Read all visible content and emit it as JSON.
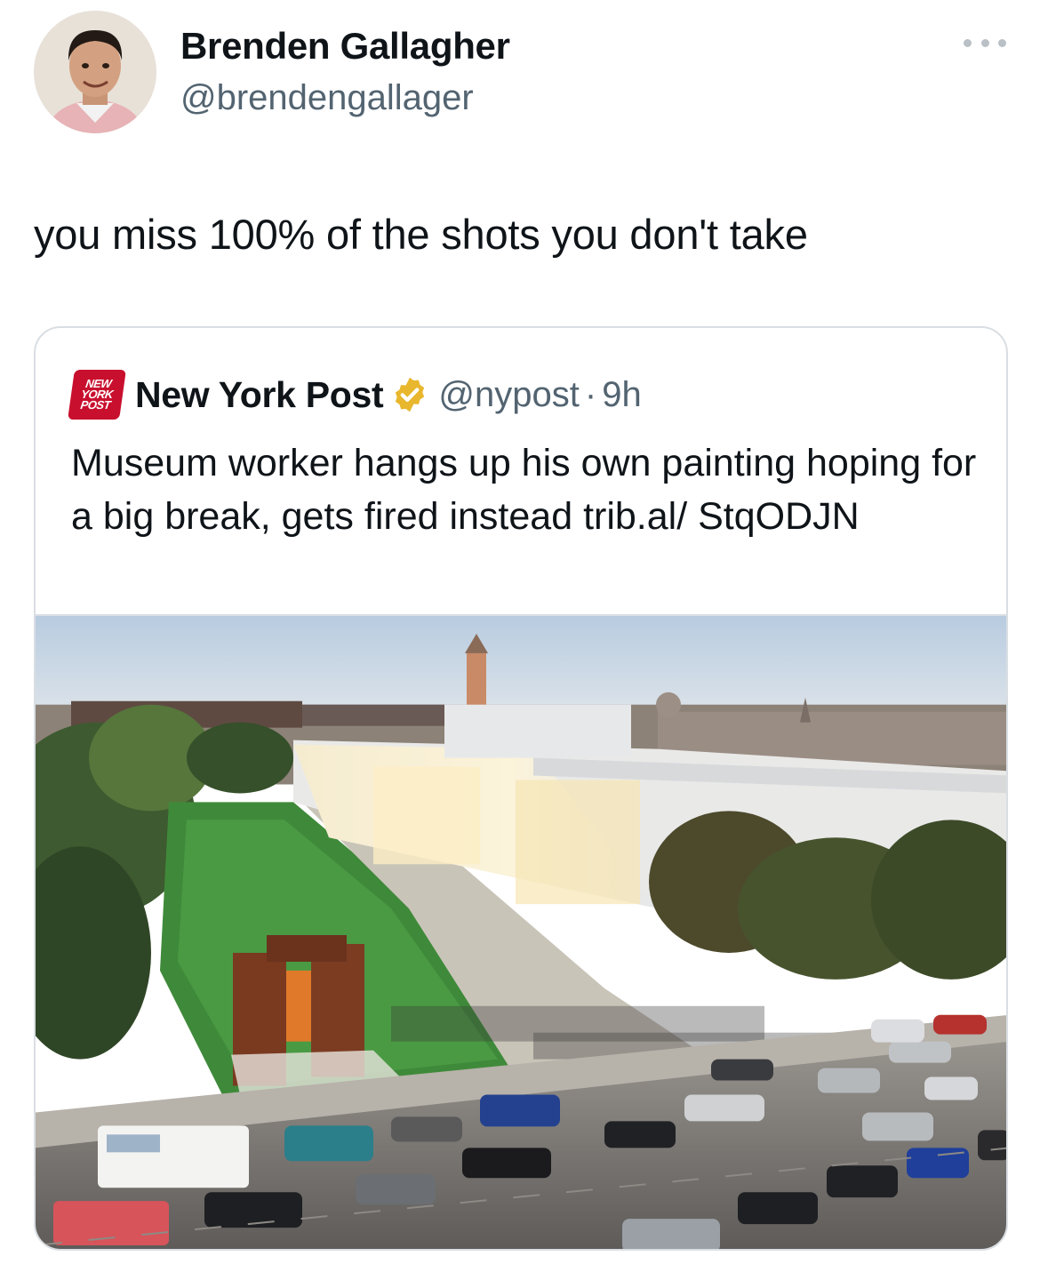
{
  "author": {
    "name": "Brenden Gallagher",
    "handle": "@brendengallager",
    "avatar_icon": "profile-photo"
  },
  "tweet": {
    "text": "you miss 100% of the shots you don't take",
    "more_icon": "more-options-icon"
  },
  "quoted_tweet": {
    "logo_lines": [
      "NEW",
      "YORK",
      "POST"
    ],
    "name": "New York Post",
    "verified_icon": "verified-badge-icon",
    "verified_color": "#e8b72d",
    "handle": "@nypost",
    "separator": "·",
    "time": "9h",
    "text": "Museum worker hangs up his own painting hoping for a big break, gets fired instead trib.al/ StqODJN",
    "media_alt": "aerial-photo-museum-at-dusk"
  },
  "colors": {
    "text_primary": "#0f1419",
    "text_secondary": "#536471",
    "border": "#d9dee3",
    "nyp_red": "#c8102e"
  }
}
